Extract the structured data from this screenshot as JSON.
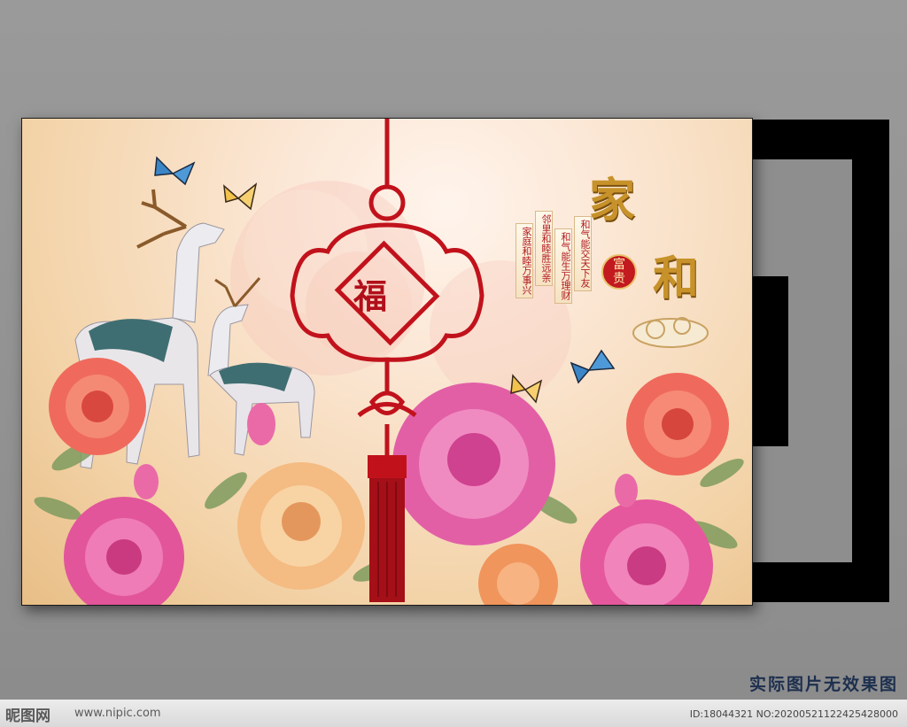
{
  "painting": {
    "fu_char": "福",
    "title_jia": "家",
    "title_he": "和",
    "seal_line1": "富",
    "seal_line2": "贵",
    "couplets": [
      "和气能交天下友",
      "和气能生万理财",
      "邻里和睦胜远亲",
      "家庭和睦万事兴"
    ]
  },
  "caption": "实际图片无效果图",
  "watermark": {
    "logo": "昵图网",
    "url": "www.nipic.com",
    "id_line": "ID:18044321 NO:20200521122425428000"
  }
}
